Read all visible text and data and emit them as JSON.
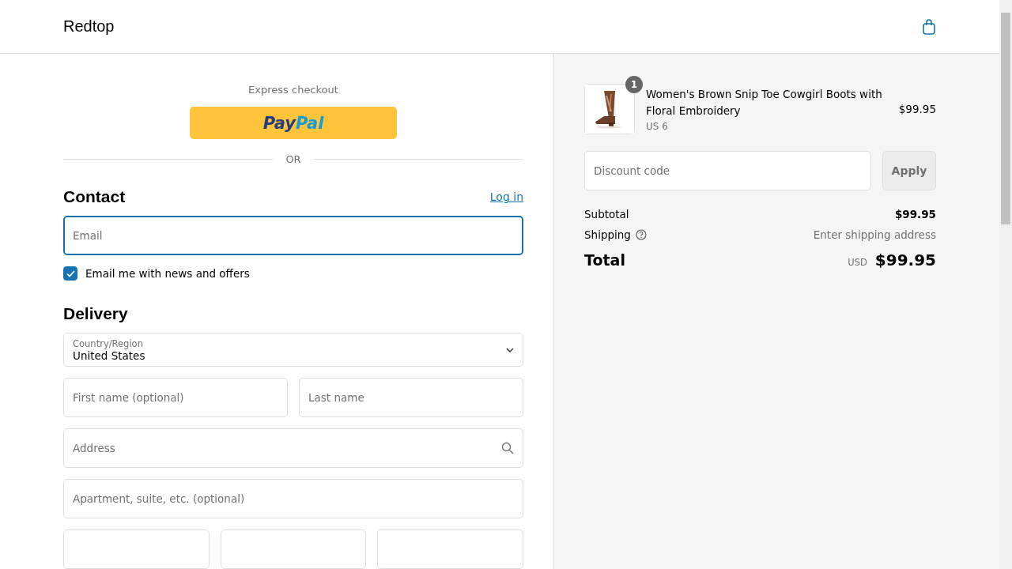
{
  "header": {
    "store_name": "Redtop"
  },
  "express": {
    "title": "Express checkout",
    "paypal": [
      "Pay",
      "Pal"
    ],
    "divider": "OR"
  },
  "contact": {
    "title": "Contact",
    "login_link": "Log in",
    "email": {
      "placeholder": "Email",
      "focused": true
    },
    "newsletter": {
      "label": "Email me with news and offers",
      "checked": true
    }
  },
  "delivery": {
    "title": "Delivery",
    "country": {
      "label": "Country/Region",
      "value": "United States"
    },
    "fields": [
      {
        "kind": "pair",
        "items": [
          {
            "placeholder": "First name (optional)"
          },
          {
            "placeholder": "Last name"
          }
        ]
      },
      {
        "kind": "search",
        "items": [
          {
            "placeholder": "Address"
          }
        ]
      },
      {
        "kind": "single",
        "items": [
          {
            "placeholder": "Apartment, suite, etc. (optional)"
          }
        ]
      },
      {
        "kind": "blank_row"
      }
    ]
  },
  "summary": {
    "items": [
      {
        "quantity": "1",
        "name": "Women's Brown Snip Toe Cowgirl Boots with Floral Embroidery",
        "variant": "US 6",
        "price": "$99.95"
      }
    ],
    "discount": {
      "placeholder": "Discount code",
      "button": "Apply"
    },
    "subtotal": {
      "label": "Subtotal",
      "value": "$99.95"
    },
    "shipping": {
      "label": "Shipping",
      "value": "Enter shipping address"
    },
    "total": {
      "label": "Total",
      "currency": "USD",
      "value": "$99.95"
    }
  }
}
